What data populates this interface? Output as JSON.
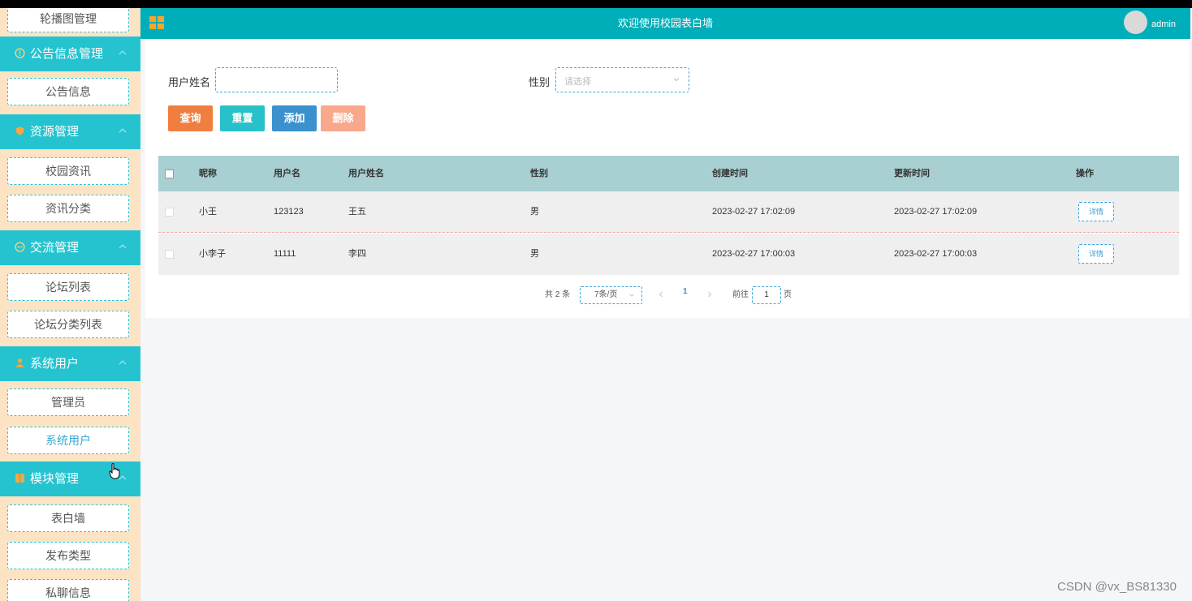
{
  "header": {
    "title": "欢迎使用校园表白墙",
    "user": "admin"
  },
  "sidebar": {
    "items": [
      {
        "label": "轮播图管理"
      },
      {
        "group": "公告信息管理"
      },
      {
        "label": "公告信息"
      },
      {
        "group": "资源管理"
      },
      {
        "label": "校园资讯"
      },
      {
        "label": "资讯分类"
      },
      {
        "group": "交流管理"
      },
      {
        "label": "论坛列表"
      },
      {
        "label": "论坛分类列表"
      },
      {
        "group": "系统用户"
      },
      {
        "label": "管理员"
      },
      {
        "label": "系统用户",
        "active": true
      },
      {
        "group": "模块管理"
      },
      {
        "label": "表白墙"
      },
      {
        "label": "发布类型"
      },
      {
        "label": "私聊信息"
      }
    ]
  },
  "search": {
    "name_label": "用户姓名",
    "name_value": "",
    "gender_label": "性别",
    "gender_placeholder": "请选择"
  },
  "buttons": {
    "query": "查询",
    "reset": "重置",
    "add": "添加",
    "delete": "删除"
  },
  "table": {
    "headers": [
      "昵称",
      "用户名",
      "用户姓名",
      "性别",
      "创建时间",
      "更新时间",
      "操作"
    ],
    "rows": [
      {
        "nickname": "小王",
        "username": "123123",
        "realname": "王五",
        "gender": "男",
        "created": "2023-02-27 17:02:09",
        "updated": "2023-02-27 17:02:09",
        "action": "详情"
      },
      {
        "nickname": "小李子",
        "username": "11111",
        "realname": "李四",
        "gender": "男",
        "created": "2023-02-27 17:00:03",
        "updated": "2023-02-27 17:00:03",
        "action": "详情"
      }
    ]
  },
  "pagination": {
    "total": "共 2 条",
    "page_size": "7条/页",
    "current": "1",
    "goto_label": "前往",
    "goto_value": "1",
    "goto_suffix": "页"
  },
  "watermark": "CSDN @vx_BS81330",
  "colors": {
    "header": "#00aeb9",
    "sidebar_group": "#25c3cf",
    "sidebar_bg": "#fbe3c4",
    "table_header": "#a8cfd1"
  }
}
